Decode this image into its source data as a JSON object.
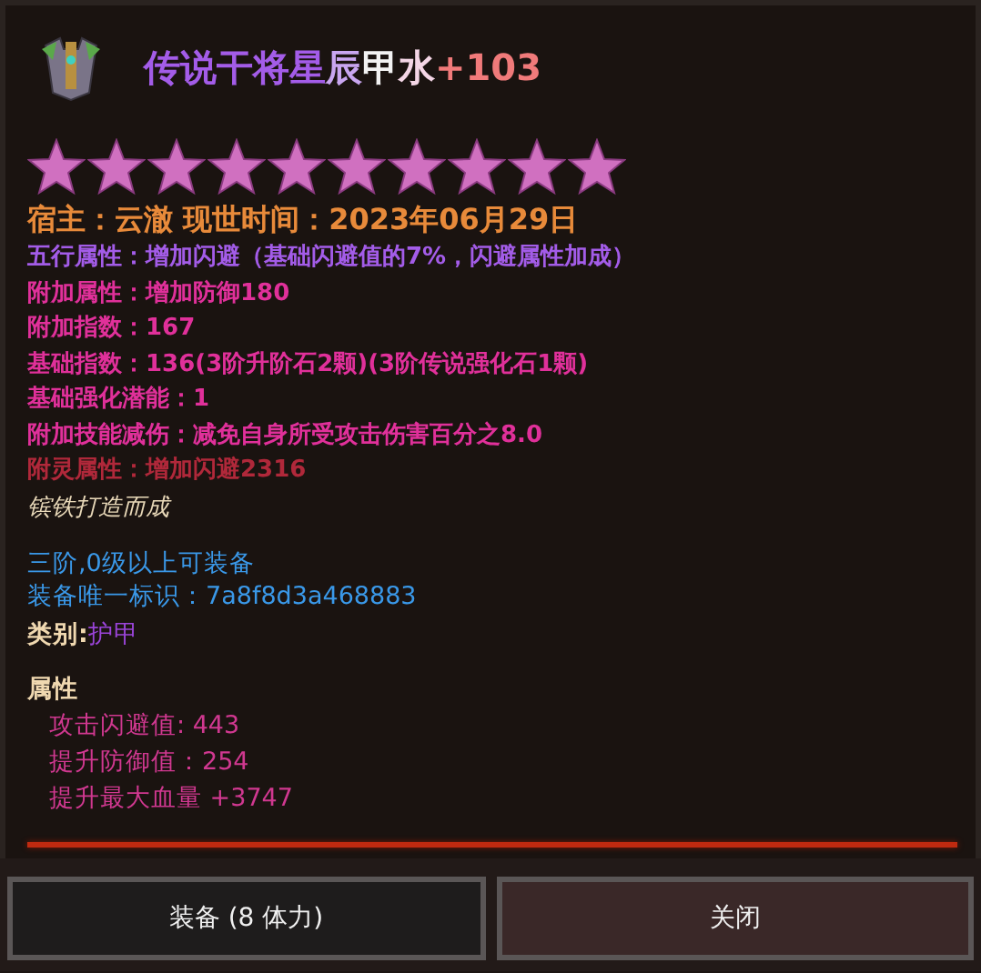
{
  "title": [
    {
      "text": "传说干将星",
      "color": "#a35ce8"
    },
    {
      "text": "辰",
      "color": "#c9a6f0"
    },
    {
      "text": "甲",
      "color": "#f2f2f2"
    },
    {
      "text": "水",
      "color": "#f4d6e6"
    },
    {
      "text": "+103",
      "color": "#f07a7a"
    }
  ],
  "stars": 10,
  "owner": "宿主：云澈 现世时间：2023年06月29日",
  "stats": [
    {
      "text": "五行属性：增加闪避（基础闪避值的7%，闪避属性加成）",
      "color": "#a35ce8"
    },
    {
      "text": "附加属性：增加防御180",
      "color": "#e0309a"
    },
    {
      "text": "附加指数：167",
      "color": "#e0309a"
    },
    {
      "text": "基础指数：136(3阶升阶石2颗)(3阶传说强化石1颗)",
      "color": "#e0309a"
    },
    {
      "text": "基础强化潜能：1",
      "color": "#e0309a"
    },
    {
      "text": "附加技能减伤：减免自身所受攻击伤害百分之8.0",
      "color": "#e0309a"
    },
    {
      "text": "附灵属性：增加闪避2316",
      "color": "#b0283a"
    }
  ],
  "flavor": "镔铁打造而成",
  "requirement": "三阶,0级以上可装备",
  "unique_id": "装备唯一标识：7a8f8d3a468883",
  "category": {
    "label": "类别:",
    "value": "护甲"
  },
  "attributes": {
    "heading": "属性",
    "items": [
      "攻击闪避值: 443",
      "提升防御值：254",
      "提升最大血量 +3747"
    ]
  },
  "buttons": [
    {
      "label": "装备 (8 体力)",
      "kind": "dark"
    },
    {
      "label": "关闭",
      "kind": "red"
    }
  ]
}
